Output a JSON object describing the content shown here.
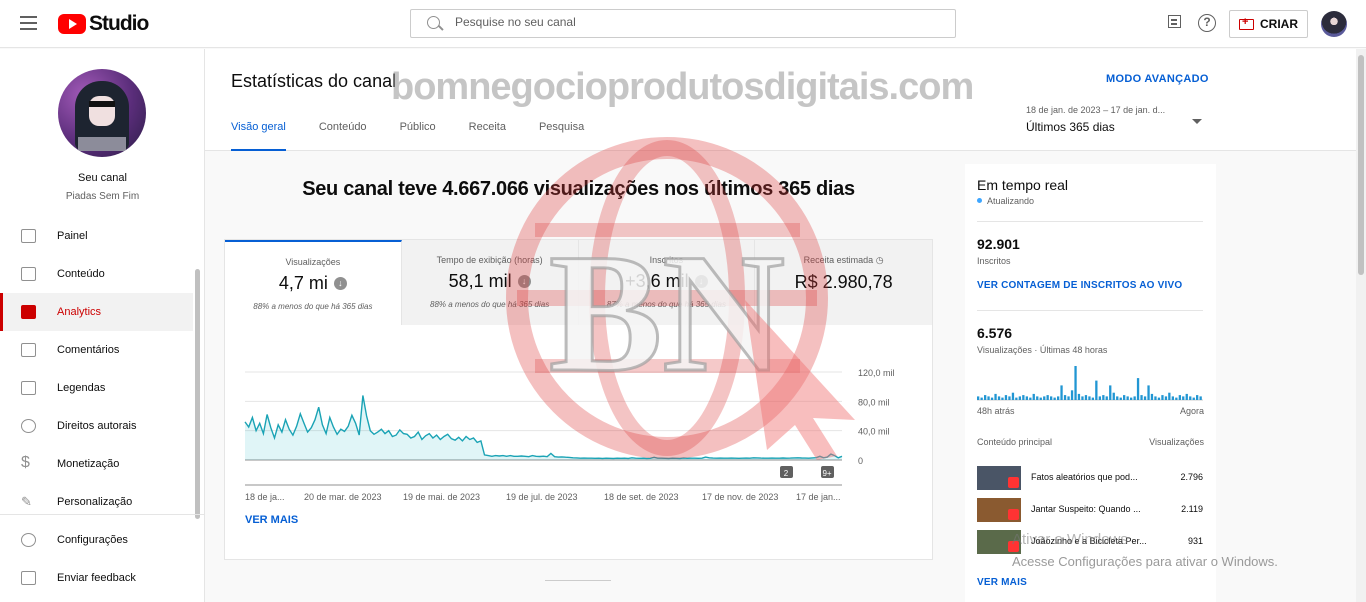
{
  "header": {
    "logo_text": "Studio",
    "search_placeholder": "Pesquise no seu canal",
    "create_label": "CRIAR"
  },
  "channel": {
    "title": "Seu canal",
    "name": "Piadas Sem Fim"
  },
  "sidebar": {
    "items": [
      {
        "label": "Painel",
        "icon": "dashboard-icon"
      },
      {
        "label": "Conteúdo",
        "icon": "content-icon"
      },
      {
        "label": "Analytics",
        "icon": "analytics-icon",
        "active": true
      },
      {
        "label": "Comentários",
        "icon": "comments-icon"
      },
      {
        "label": "Legendas",
        "icon": "subtitles-icon"
      },
      {
        "label": "Direitos autorais",
        "icon": "copyright-icon"
      },
      {
        "label": "Monetização",
        "icon": "dollar-icon"
      },
      {
        "label": "Personalização",
        "icon": "magic-wand-icon"
      }
    ],
    "bottom": [
      {
        "label": "Configurações",
        "icon": "gear-icon"
      },
      {
        "label": "Enviar feedback",
        "icon": "feedback-icon"
      }
    ]
  },
  "page": {
    "title": "Estatísticas do canal",
    "tabs": [
      "Visão geral",
      "Conteúdo",
      "Público",
      "Receita",
      "Pesquisa"
    ],
    "advanced_mode": "MODO AVANÇADO",
    "date_range": "18 de jan. de 2023 – 17 de jan. d...",
    "period": "Últimos 365 dias"
  },
  "overview": {
    "headline": "Seu canal teve 4.667.066 visualizações nos últimos 365 dias",
    "metrics": [
      {
        "label": "Visualizações",
        "value": "4,7 mi",
        "note": "88% a menos do que há 365 dias"
      },
      {
        "label": "Tempo de exibição (horas)",
        "value": "58,1 mil",
        "note": "88% a menos do que há 365 dias"
      },
      {
        "label": "Inscritos",
        "value": "+3,6 mil",
        "note": "87% a menos do que há 365 dias"
      },
      {
        "label": "Receita estimada",
        "value": "R$ 2.980,78",
        "note": ""
      }
    ],
    "see_more": "VER MAIS"
  },
  "chart_data": {
    "type": "area",
    "x_tick_labels": [
      "18 de ja...",
      "20 de mar. de 2023",
      "19 de mai. de 2023",
      "19 de jul. de 2023",
      "18 de set. de 2023",
      "17 de nov. de 2023",
      "17 de jan..."
    ],
    "y_tick_labels": [
      "120,0 mil",
      "80,0 mil",
      "40,0 mil",
      "0"
    ],
    "ylim": [
      0,
      120000
    ],
    "grid": true,
    "markers": [
      "2",
      "9+"
    ],
    "series": [
      {
        "values": [
          52000,
          45000,
          58000,
          40000,
          50000,
          36000,
          62000,
          44000,
          30000,
          48000,
          38000,
          55000,
          42000,
          34000,
          46000,
          63000,
          50000,
          38000,
          44000,
          55000,
          72000,
          48000,
          36000,
          58000,
          45000,
          35000,
          42000,
          39000,
          46000,
          61000,
          50000,
          34000,
          88000,
          60000,
          40000,
          35000,
          38000,
          42000,
          36000,
          40000,
          32000,
          34000,
          41000,
          36000,
          35000,
          30000,
          32000,
          38000,
          28000,
          33000,
          36000,
          30000,
          34000,
          28000,
          32000,
          35000,
          29000,
          27000,
          31000,
          26000,
          32000,
          28000,
          30000,
          24000,
          26000,
          7000,
          6000,
          5000,
          6000,
          5500,
          6000,
          5000,
          6000,
          5000,
          5000,
          5500,
          5000,
          4500,
          6000,
          5000,
          4800,
          5200,
          4500,
          9000,
          4500,
          4000,
          4200,
          3800,
          3500,
          3000,
          2800,
          2500,
          2600,
          2500,
          2400,
          2300,
          2500,
          2200,
          2400,
          2300,
          2200,
          2500,
          2300,
          2400,
          2200,
          3000,
          2500,
          2300,
          2400,
          2200,
          2300,
          3500,
          2500,
          2400,
          2300,
          2200,
          2400,
          2300,
          2200,
          2600,
          2300,
          2500,
          2400,
          2300,
          2500,
          4000,
          3000,
          2600,
          2400,
          2600,
          2500,
          2400,
          2600,
          2500,
          2300,
          2400,
          2600,
          2500,
          3000,
          2800,
          2600,
          2500,
          2400,
          2600,
          2500,
          2400,
          2700,
          2500,
          2600,
          2800,
          3000,
          2700,
          2600,
          2500,
          2800,
          3200,
          5000,
          3000,
          4000,
          8000,
          6000,
          3000,
          5000
        ]
      }
    ]
  },
  "realtime": {
    "title": "Em tempo real",
    "status": "Atualizando",
    "subscribers": "92.901",
    "subscribers_label": "Inscritos",
    "live_count_link": "VER CONTAGEM DE INSCRITOS AO VIVO",
    "views": "6.576",
    "views_label": "Visualizações · Últimas 48 horas",
    "bars": [
      3,
      2,
      4,
      3,
      2,
      5,
      3,
      2,
      4,
      3,
      6,
      2,
      3,
      4,
      3,
      2,
      5,
      3,
      2,
      3,
      4,
      3,
      2,
      3,
      12,
      4,
      3,
      8,
      28,
      5,
      3,
      4,
      3,
      2,
      16,
      3,
      4,
      3,
      12,
      6,
      3,
      2,
      4,
      3,
      2,
      3,
      18,
      4,
      3,
      12,
      5,
      3,
      2,
      4,
      3,
      6,
      3,
      2,
      4,
      3,
      5,
      3,
      2,
      4,
      3
    ],
    "axis_start": "48h atrás",
    "axis_end": "Agora",
    "top_content_label": "Conteúdo principal",
    "top_views_label": "Visualizações",
    "videos": [
      {
        "title": "Fatos aleatórios que pod...",
        "views": "2.796"
      },
      {
        "title": "Jantar Suspeito: Quando ...",
        "views": "2.119"
      },
      {
        "title": "Joãozinho e a Bicicleta Per...",
        "views": "931"
      }
    ],
    "see_more": "VER MAIS"
  },
  "overlay": {
    "watermark": "bomnegocioprodutosdigitais.com",
    "watermark_logo": "BN",
    "activate_title": "Ativar o Windows",
    "activate_sub": "Acesse Configurações para ativar o Windows."
  }
}
